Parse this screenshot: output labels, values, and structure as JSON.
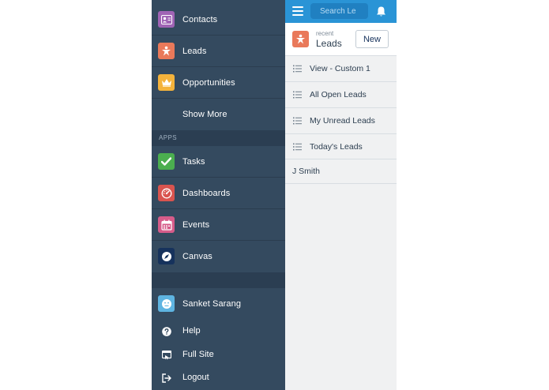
{
  "sidebar": {
    "items": [
      {
        "label": "Contacts",
        "icon": "contact-card-icon",
        "color": "#a064b5"
      },
      {
        "label": "Leads",
        "icon": "lead-star-person-icon",
        "color": "#e9795a"
      },
      {
        "label": "Opportunities",
        "icon": "crown-icon",
        "color": "#f4b33c"
      },
      {
        "label": "Show More"
      }
    ],
    "apps_heading": "APPS",
    "apps": [
      {
        "label": "Tasks",
        "icon": "checkmark-icon",
        "color": "#4bae4f"
      },
      {
        "label": "Dashboards",
        "icon": "gauge-icon",
        "color": "#d9544f"
      },
      {
        "label": "Events",
        "icon": "calendar-icon",
        "color": "#d65c8a"
      },
      {
        "label": "Canvas",
        "icon": "compass-icon",
        "color": "#16325c"
      }
    ],
    "user": {
      "label": "Sanket Sarang",
      "icon": "smiley-avatar-icon",
      "color": "#5eb4e1"
    },
    "footer": [
      {
        "label": "Help",
        "icon": "help-circle-icon"
      },
      {
        "label": "Full Site",
        "icon": "full-site-icon"
      },
      {
        "label": "Logout",
        "icon": "logout-icon"
      }
    ]
  },
  "topbar": {
    "search_placeholder": "Search Le",
    "color": "#2a94d6"
  },
  "header": {
    "subtitle": "recent",
    "title": "Leads",
    "new_label": "New"
  },
  "list_views": [
    {
      "label": "View - Custom 1"
    },
    {
      "label": "All Open Leads"
    },
    {
      "label": "My Unread Leads"
    },
    {
      "label": "Today's Leads"
    }
  ],
  "recent_items": [
    {
      "label": "J Smith"
    }
  ]
}
